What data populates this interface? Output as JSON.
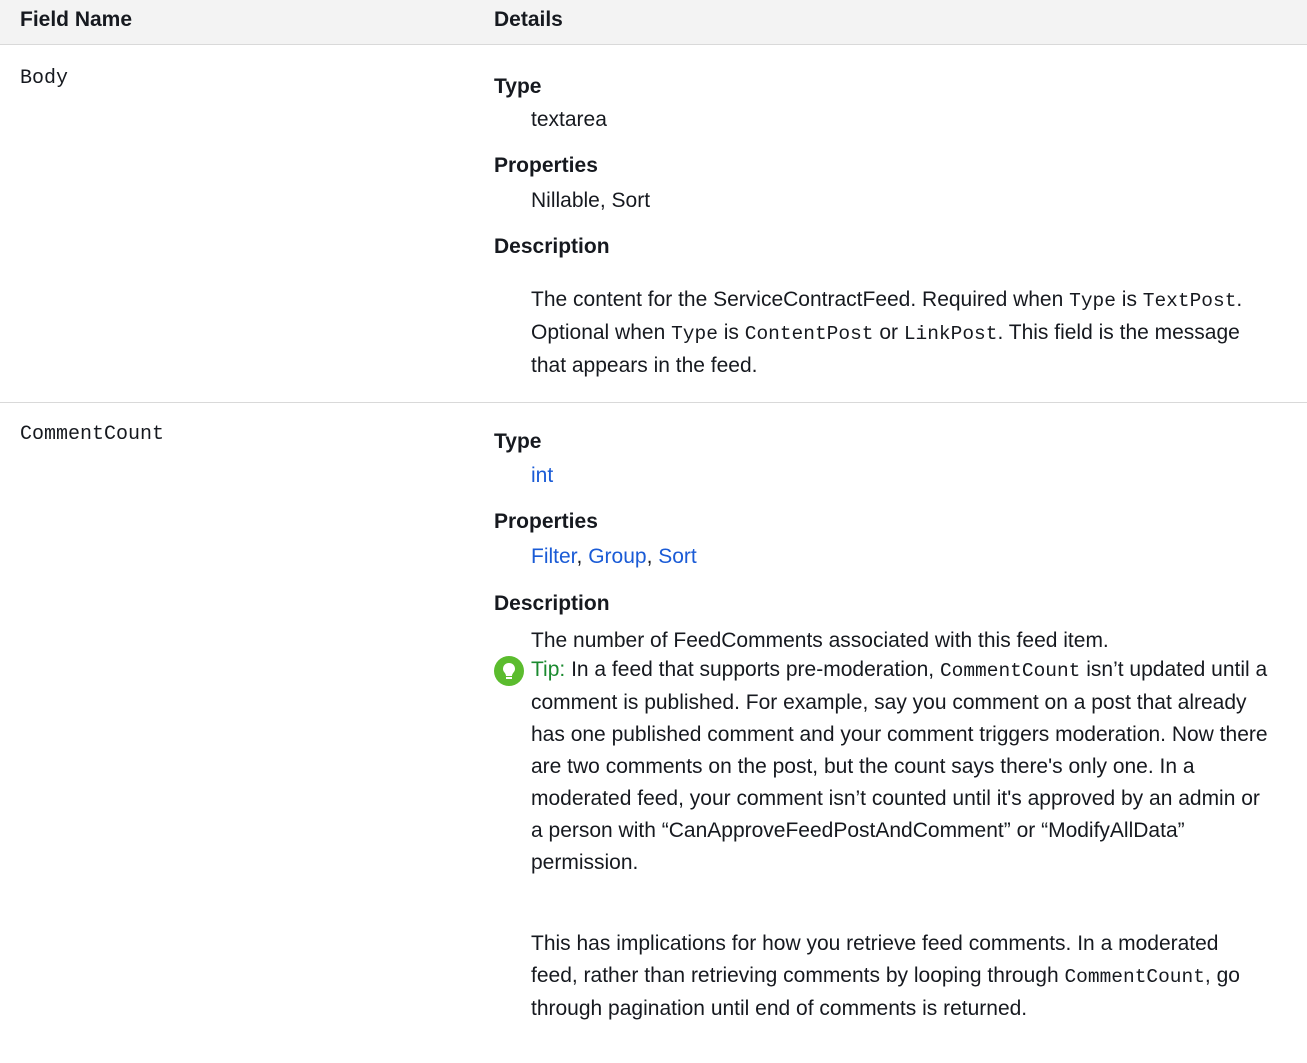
{
  "table": {
    "headers": {
      "field": "Field Name",
      "details": "Details"
    }
  },
  "rows": [
    {
      "field_name": "Body",
      "type_label": "Type",
      "type_value": "textarea",
      "properties_label": "Properties",
      "properties_value": "Nillable, Sort",
      "description_label": "Description",
      "description": {
        "t1": "The content for the ServiceContractFeed. Required when ",
        "c1": "Type",
        "t2": " is ",
        "c2": "TextPost",
        "t3": ". Optional when ",
        "c3": "Type",
        "t4": " is ",
        "c4": "ContentPost",
        "t5": " or ",
        "c5": "LinkPost",
        "t6": ". This field is the message that appears in the feed."
      }
    },
    {
      "field_name": "CommentCount",
      "type_label": "Type",
      "type_value": "int",
      "properties_label": "Properties",
      "properties_links": [
        "Filter",
        "Group",
        "Sort"
      ],
      "properties_sep": ", ",
      "description_label": "Description",
      "description": "The number of FeedComments associated with this feed item.",
      "tip": {
        "label": "Tip:",
        "t1": " In a feed that supports pre-moderation, ",
        "c1": "CommentCount",
        "t2": " isn’t updated until a comment is published. For example, say you comment on a post that already has one published comment and your comment triggers moderation. Now there are two comments on the post, but the count says there's only one. In a moderated feed, your comment isn’t counted until it's approved by an admin or a person with “CanApproveFeedPostAndComment” or “ModifyAllData” permission.",
        "p2_t1": "This has implications for how you retrieve feed comments. In a moderated feed, rather than retrieving comments by looping through ",
        "p2_c1": "CommentCount",
        "p2_t2": ", go through pagination until end of comments is returned."
      }
    }
  ],
  "colors": {
    "link": "#1a5bd6",
    "tip_icon": "#5bbc2e",
    "tip_label": "#1a8a2f",
    "header_bg": "#f3f3f3"
  },
  "icons": {
    "tip": "lightbulb-icon"
  }
}
